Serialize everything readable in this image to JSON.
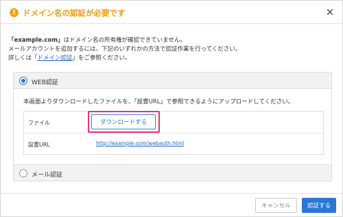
{
  "dialog": {
    "icon": "warning-icon",
    "title": "ドメイン名の認証が必要です",
    "close_icon": "close-icon",
    "close_glyph": "✕",
    "warn_glyph": "!"
  },
  "intro": {
    "line1_domain": "「example.com」",
    "line1_rest": "はドメイン名の所有権が確認できていません。",
    "line2": "メールアカウントを追加するには、下記のいずれかの方法で認証作業を行ってください。",
    "line3_prefix": "詳しくは「",
    "line3_link": "ドメイン認証",
    "line3_suffix": "」をご参照ください。"
  },
  "web_auth": {
    "label": "WEB認証",
    "selected": true,
    "description": "本画面よりダウンロードしたファイルを、「設置URL」で参照できるようにアップロードしてください。",
    "rows": [
      {
        "label": "ファイル",
        "button": "ダウンロードする"
      },
      {
        "label": "設置URL",
        "url": "http://example.com/webauth.html"
      }
    ]
  },
  "mail_auth": {
    "label": "メール認証",
    "selected": false
  },
  "footer": {
    "cancel_label": "キャンセル",
    "submit_label": "認証する"
  },
  "colors": {
    "accent": "#2a78d6",
    "warning": "#f09a12",
    "highlight": "#e6336d",
    "link": "#1a66c2"
  }
}
